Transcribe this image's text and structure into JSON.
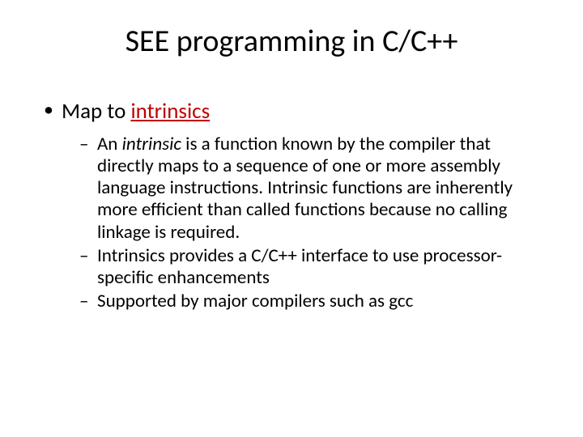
{
  "title": "SEE programming in C/C++",
  "bullet": {
    "prefix": "Map to ",
    "highlight": "intrinsics"
  },
  "sub": [
    {
      "prefix": "An ",
      "italic": "intrinsic",
      "rest": " is a function known by the compiler that directly maps to a sequence of one or more assembly language instructions. Intrinsic functions are inherently more efficient than called functions because no calling linkage is required."
    },
    {
      "text": "Intrinsics provides a C/C++ interface to use processor-specific enhancements"
    },
    {
      "text": "Supported by major compilers such as gcc"
    }
  ]
}
